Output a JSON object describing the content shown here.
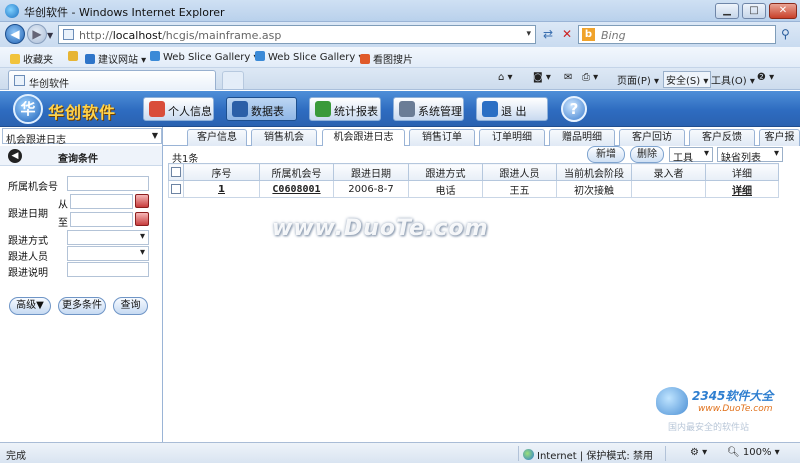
{
  "window": {
    "title": "华创软件 - Windows Internet Explorer",
    "min_label": "▁",
    "max_label": "□",
    "close_label": "✕"
  },
  "address_bar": {
    "url_prefix": "http://",
    "url_host": "localhost",
    "url_path": "/hcgis/mainframe.asp",
    "search_placeholder": "Bing"
  },
  "favorites_bar": {
    "favorites_label": "收藏夹",
    "items": [
      "建议网站 ▾",
      "Web Slice Gallery ▾",
      "Web Slice Gallery ▾",
      "看图搜片"
    ]
  },
  "tab_bar": {
    "tab_title": "华创软件",
    "page_menu": "页面(P) ▾",
    "safety_menu": "安全(S) ▾",
    "tools_menu": "工具(O) ▾",
    "help_menu": "❷ ▾"
  },
  "app": {
    "brand_name": "华创软件",
    "modules": [
      {
        "label": "个人信息",
        "color": "#d94d3a"
      },
      {
        "label": "数据表",
        "color": "#2b5fa8"
      },
      {
        "label": "统计报表",
        "color": "#3a9a3a"
      },
      {
        "label": "系统管理",
        "color": "#6b7d96"
      },
      {
        "label": "退  出",
        "color": "#2b6fc4"
      }
    ],
    "help_label": "?"
  },
  "left_panel": {
    "module_select": "机会跟进日志",
    "query_title": "查询条件",
    "fields": {
      "opportunity_no": "所属机会号",
      "follow_date": "跟进日期",
      "from": "从",
      "to": "至",
      "method": "跟进方式",
      "person": "跟进人员",
      "desc": "跟进说明"
    },
    "buttons": {
      "advanced": "高级▼",
      "more": "更多条件",
      "search": "查询"
    }
  },
  "content_tabs": [
    "客户信息",
    "销售机会",
    "机会跟进日志",
    "销售订单",
    "订单明细",
    "赠品明细",
    "客户回访",
    "客户反馈",
    "客户报"
  ],
  "grid": {
    "record_count": "共1条",
    "new_label": "新增",
    "delete_label": "删除",
    "tools_select": "工具",
    "view_select": "缺省列表",
    "columns": [
      "序号",
      "所属机会号",
      "跟进日期",
      "跟进方式",
      "跟进人员",
      "当前机会阶段",
      "录入者",
      "详细"
    ],
    "rows": [
      {
        "no": "1",
        "opportunity": "C0608001",
        "date": "2006-8-7",
        "method": "电话",
        "person": "王五",
        "stage": "初次接触",
        "entered_by": "",
        "detail": "详细"
      }
    ]
  },
  "watermark": {
    "main": "www.DuoTe.com",
    "brand": "2345软件大全",
    "brand_url": "www.DuoTe.com",
    "brand_sub": "国内最安全的软件站"
  },
  "status_bar": {
    "status": "完成",
    "zone": "Internet | 保护模式: 禁用",
    "zoom": "100%"
  }
}
